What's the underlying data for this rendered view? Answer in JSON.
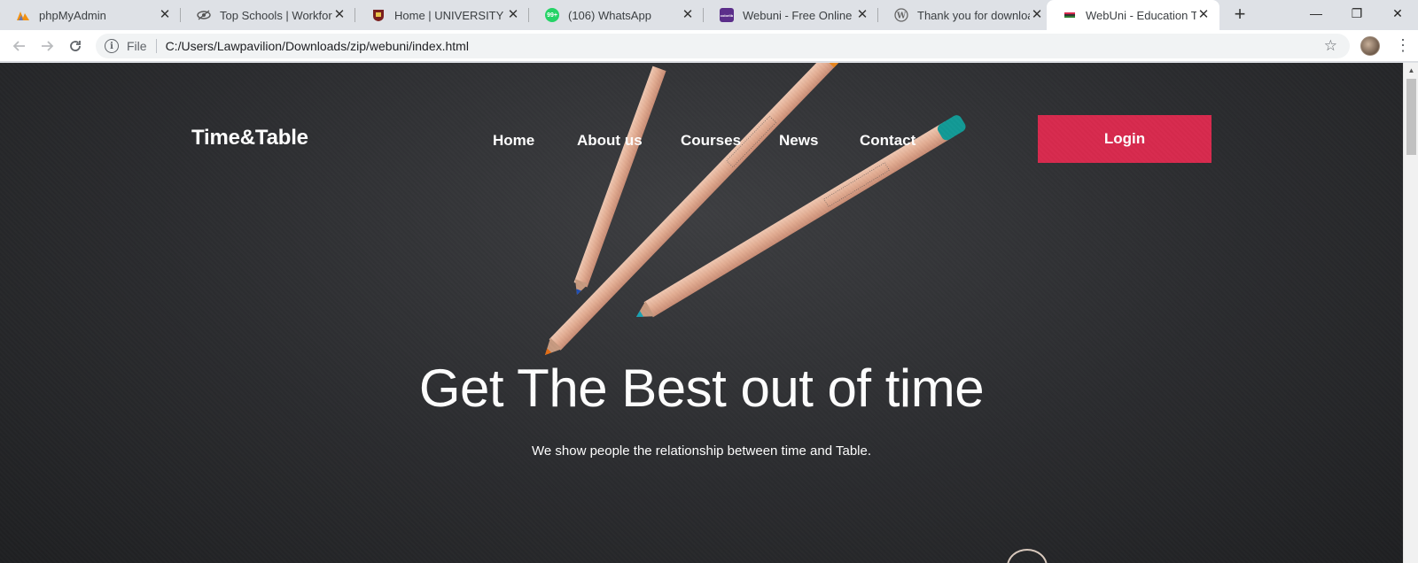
{
  "browser": {
    "tabs": [
      {
        "title": "phpMyAdmin",
        "icon": "phpmyadmin-icon",
        "active": false
      },
      {
        "title": "Top Schools | Workforce",
        "icon": "eye-icon",
        "active": false
      },
      {
        "title": "Home | UNIVERSITY OF I",
        "icon": "university-crest-icon",
        "active": false
      },
      {
        "title": "(106) WhatsApp",
        "icon": "whatsapp-icon",
        "badge": "99+",
        "active": false
      },
      {
        "title": "Webuni - Free Online Co",
        "icon": "colorlib-icon",
        "icon_text": "colorlib",
        "active": false
      },
      {
        "title": "Thank you for download",
        "icon": "wordpress-icon",
        "active": false
      },
      {
        "title": "WebUni - Education Tem",
        "icon": "webuni-flag-icon",
        "active": true
      }
    ],
    "new_tab_label": "+",
    "window_controls": {
      "minimize": "—",
      "restore": "❐",
      "close": "✕"
    },
    "address": {
      "scheme_label": "File",
      "url": "C:/Users/Lawpavilion/Downloads/zip/webuni/index.html"
    }
  },
  "page": {
    "brand": "Time&Table",
    "nav": [
      {
        "label": "Home"
      },
      {
        "label": "About us"
      },
      {
        "label": "Courses"
      },
      {
        "label": "News"
      },
      {
        "label": "Contact"
      }
    ],
    "login_label": "Login",
    "hero": {
      "title": "Get The Best out of time",
      "subtitle": "We show people the relationship between time and Table."
    }
  },
  "colors": {
    "accent": "#d82a4e",
    "hero_bg": "#2b2c2f",
    "text": "#ffffff"
  }
}
